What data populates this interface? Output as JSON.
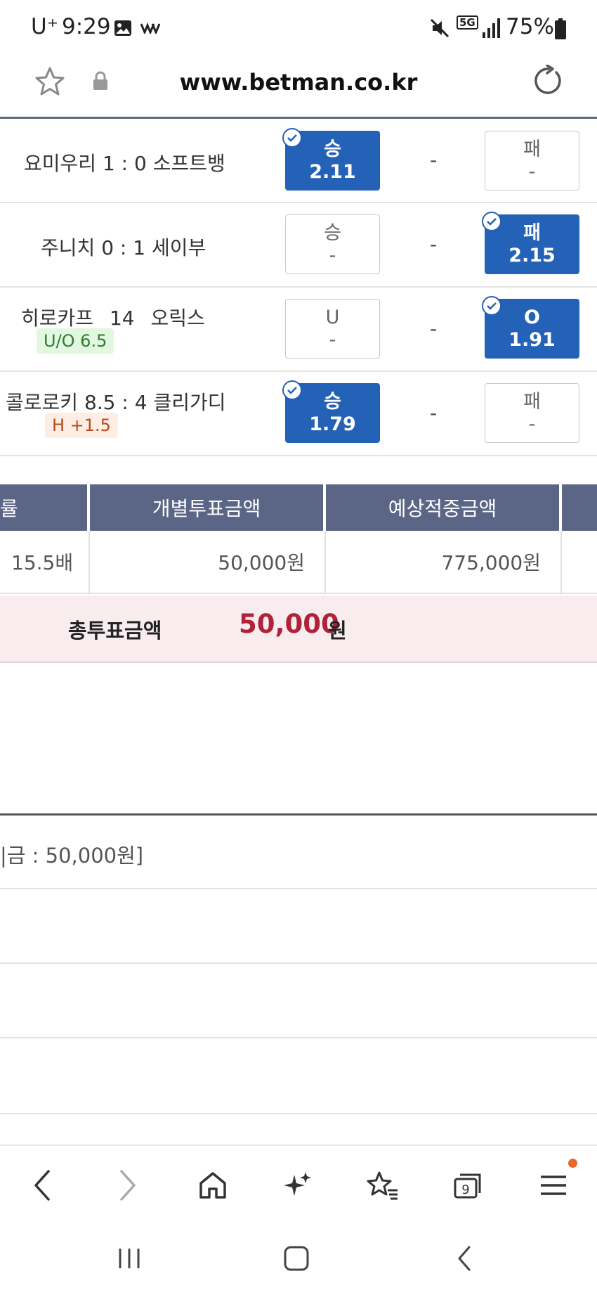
{
  "status": {
    "carrier": "U⁺",
    "time": "9:29",
    "network": "5G",
    "battery": "75%"
  },
  "browser": {
    "url": "www.betman.co.kr",
    "tab_count": "9"
  },
  "matches": [
    {
      "home": "요미우리",
      "score": "1 : 0",
      "away": "소프트뱅",
      "tag": "",
      "left": {
        "label": "승",
        "odds": "2.11",
        "selected": true
      },
      "mid": "-",
      "right": {
        "label": "패",
        "odds": "-",
        "selected": false
      }
    },
    {
      "home": "주니치",
      "score": "0 : 1",
      "away": "세이부",
      "tag": "",
      "left": {
        "label": "승",
        "odds": "-",
        "selected": false
      },
      "mid": "-",
      "right": {
        "label": "패",
        "odds": "2.15",
        "selected": true
      }
    },
    {
      "home": "히로카프",
      "score": "14",
      "away": "오릭스",
      "tag": "U/O 6.5",
      "left": {
        "label": "U",
        "odds": "-",
        "selected": false
      },
      "mid": "-",
      "right": {
        "label": "O",
        "odds": "1.91",
        "selected": true
      }
    },
    {
      "home": "콜로로키",
      "score": "8.5 : 4",
      "away": "클리가디",
      "tag": "H +1.5",
      "left": {
        "label": "승",
        "odds": "1.79",
        "selected": true
      },
      "mid": "-",
      "right": {
        "label": "패",
        "odds": "-",
        "selected": false
      }
    }
  ],
  "summary": {
    "headers": [
      "률",
      "개별투표금액",
      "예상적중금액"
    ],
    "row": [
      "15.5배",
      "50,000원",
      "775,000원"
    ]
  },
  "total": {
    "label": "총투표금액",
    "value": "50,000",
    "unit": "원"
  },
  "prize_text": "|금 : 50,000원]",
  "colors": {
    "selected": "#2462b8",
    "header": "#5b6586",
    "total_value": "#b0223a",
    "total_band": "#f9ecee"
  }
}
